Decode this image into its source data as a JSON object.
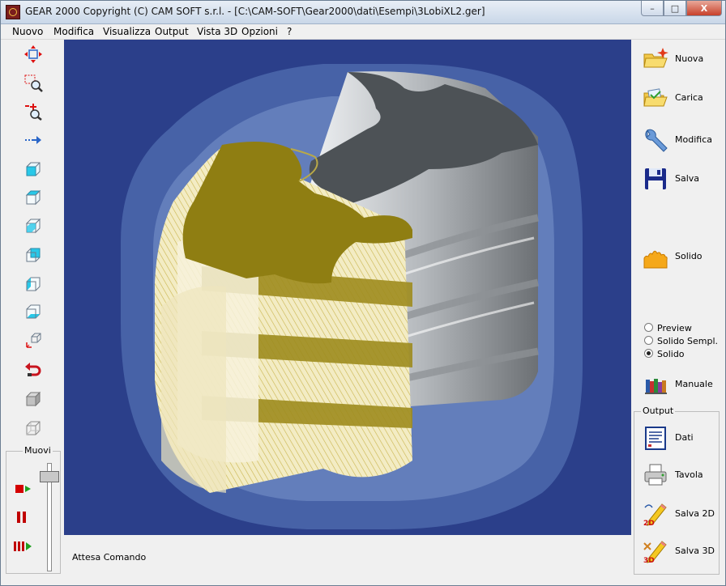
{
  "window": {
    "title": "GEAR 2000     Copyright (C)  CAM SOFT s.r.l. - [C:\\CAM-SOFT\\Gear2000\\dati\\Esempi\\3LobiXL2.ger]",
    "minimize_label": "–",
    "restore_label": "□",
    "close_label": "X"
  },
  "menu": {
    "items": [
      "Nuovo",
      "Modifica",
      "Visualizza",
      "Output",
      "Vista 3D",
      "Opzioni",
      "?"
    ]
  },
  "left_toolbar": {
    "muovi_label": "Muovi"
  },
  "right_panel": {
    "nuova": "Nuova",
    "carica": "Carica",
    "modifica": "Modifica",
    "salva": "Salva",
    "solido": "Solido",
    "radio_preview": "Preview",
    "radio_solido_sempl": "Solido Sempl.",
    "radio_solido": "Solido",
    "selected_mode": "Solido",
    "manuale": "Manuale"
  },
  "output_group": {
    "label": "Output",
    "dati": "Dati",
    "tavola": "Tavola",
    "salva2d": "Salva 2D",
    "salva3d": "Salva 3D",
    "badge_2d": "2D",
    "badge_3d": "3D"
  },
  "status": {
    "text": "Attesa Comando"
  },
  "colors": {
    "viewport_bg": "#2b3f8a",
    "rotor_gold": "#8f7e12",
    "rotor_gray": "#8a8e92"
  }
}
